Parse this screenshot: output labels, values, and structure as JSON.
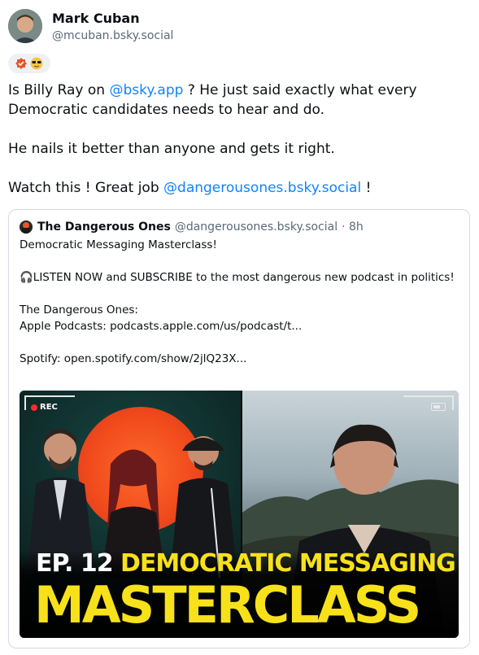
{
  "author": {
    "display_name": "Mark Cuban",
    "handle": "@mcuban.bsky.social"
  },
  "badges": {
    "icons": [
      "verified-check-icon",
      "sunglasses-emoji-icon"
    ]
  },
  "post": {
    "line1_prefix": "Is Billy Ray on ",
    "line1_mention": "@bsky.app",
    "line1_suffix": " ?  He just said exactly what every",
    "line2": "Democratic candidates needs to hear and do.",
    "line3": "He nails it better than anyone and gets it right.",
    "line4_prefix": "Watch this ! Great job ",
    "line4_mention": "@dangerousones.bsky.social",
    "line4_suffix": " !"
  },
  "quote": {
    "name": "The Dangerous Ones",
    "handle": "@dangerousones.bsky.social",
    "time": "· 8h",
    "title": "Democratic Messaging Masterclass!",
    "listen": "🎧LISTEN NOW and SUBSCRIBE to the most dangerous new podcast in politics!",
    "show_label": "The Dangerous Ones:",
    "apple": "Apple Podcasts: podcasts.apple.com/us/podcast/t...",
    "spotify": "Spotify: open.spotify.com/show/2jlQ23X..."
  },
  "thumbnail": {
    "rec_label": "REC",
    "ep_prefix": "EP. 12 ",
    "ep_highlight": "DEMOCRATIC MESSAGING",
    "big_title": "MASTERCLASS",
    "accent_yellow": "#f7e11b",
    "accent_orange": "#f04a1c"
  },
  "colors": {
    "link": "#1083fe",
    "muted": "#5a6a7a"
  }
}
